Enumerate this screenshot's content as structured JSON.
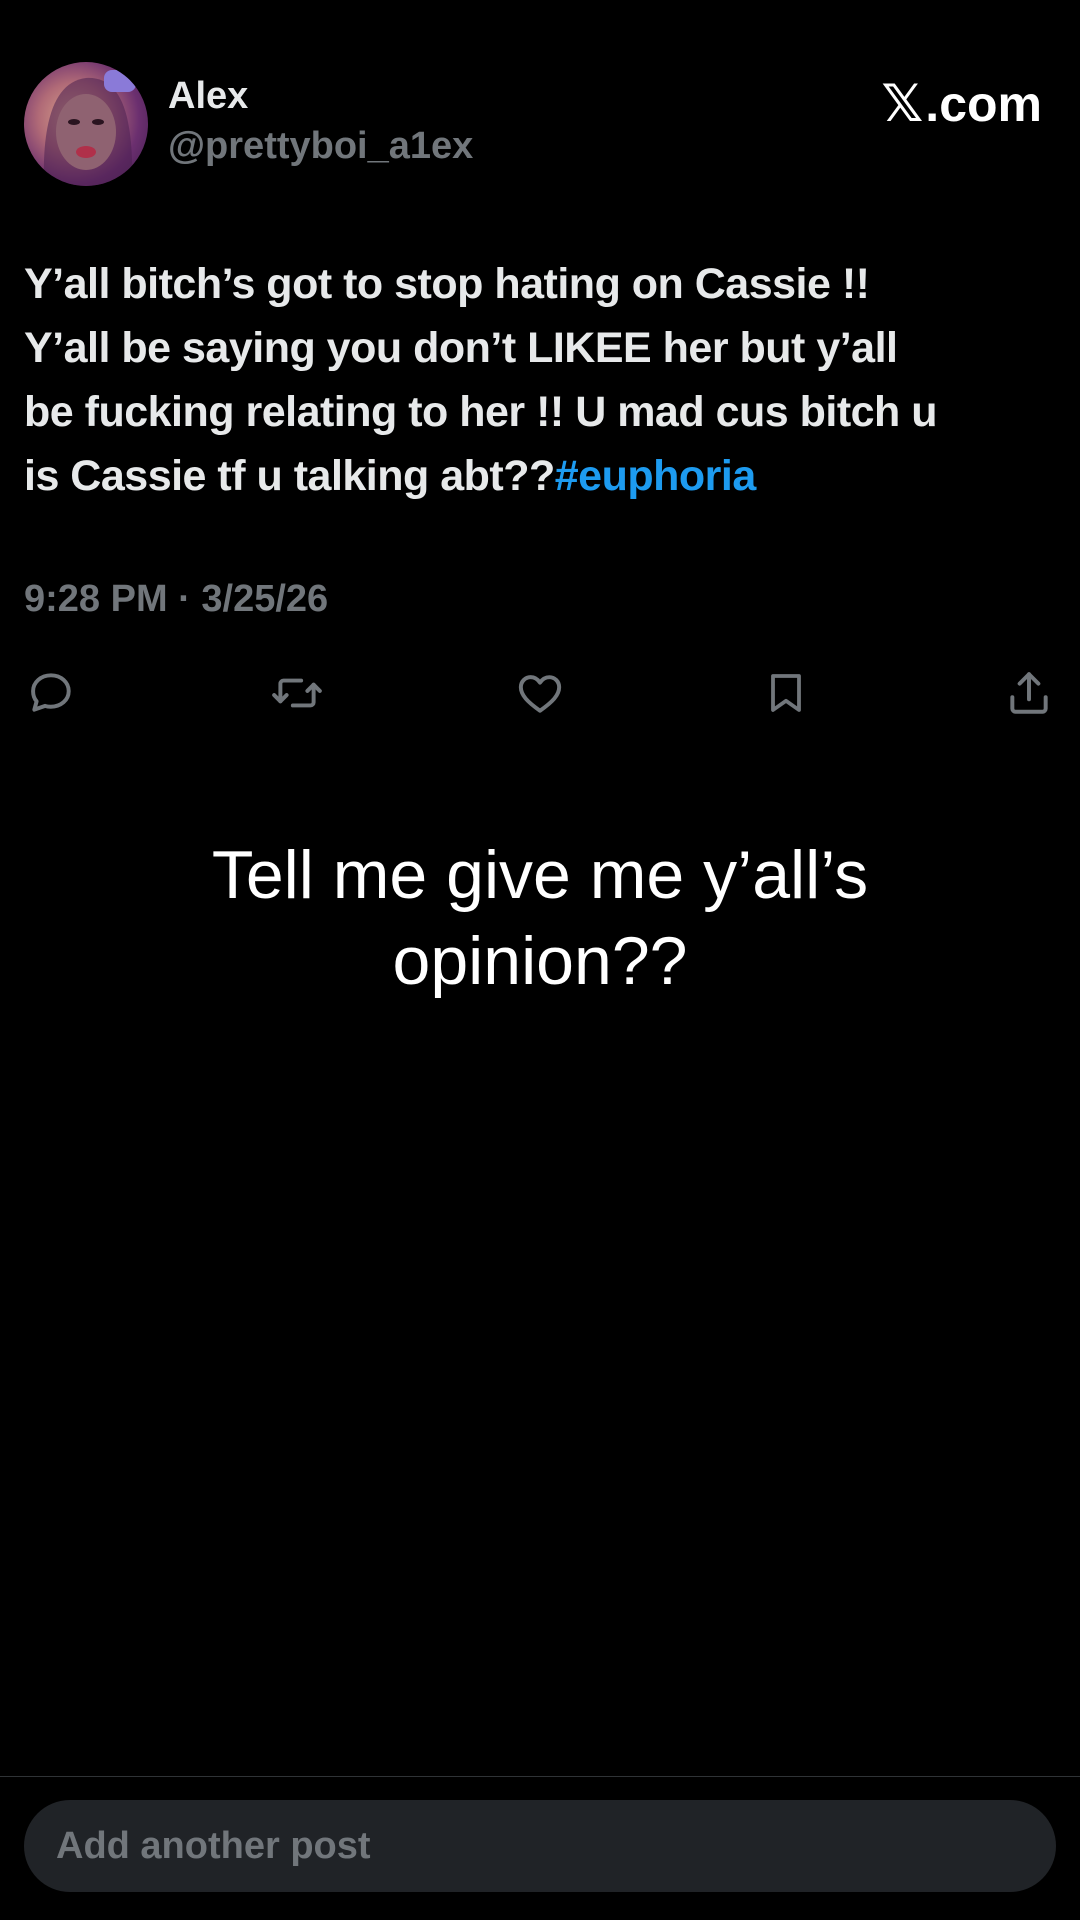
{
  "author": {
    "name": "Alex",
    "handle": "@prettyboi_a1ex"
  },
  "brand": {
    "mark": "𝕏",
    "text": ".com"
  },
  "post": {
    "lines": [
      "Y’all bitch’s  got to  stop hating on Cassie !!",
      "Y’all be saying  you  don’t LIKEE her but y’all",
      "be fucking relating  to her !! U mad cus bitch u",
      "is Cassie tf u talking abt??"
    ],
    "hashtag": "#euphoria",
    "timestamp": "9:28 PM · 3/25/26"
  },
  "actions": {
    "icons": [
      "reply-icon",
      "repost-icon",
      "like-icon",
      "bookmark-icon",
      "share-icon"
    ]
  },
  "overlay": {
    "line1": "Tell me give me y’all’s",
    "line2": "opinion??"
  },
  "composer": {
    "placeholder": "Add another post"
  },
  "colors": {
    "background": "#000000",
    "text": "#e7e9ea",
    "secondary": "#71767b",
    "accent": "#1d9bf0",
    "composer_bg": "#202327"
  }
}
